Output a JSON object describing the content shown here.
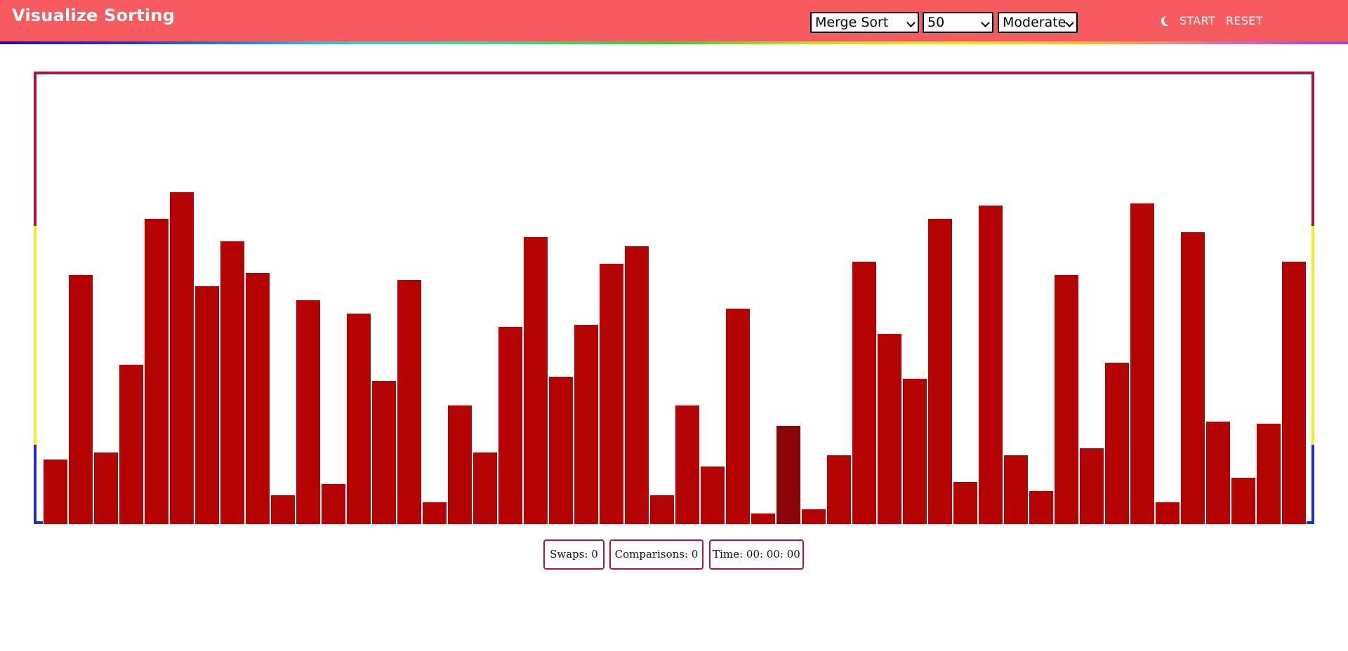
{
  "header": {
    "brand": "Visualize Sorting",
    "algorithm": {
      "selected": "Merge Sort"
    },
    "size": {
      "selected": "50"
    },
    "speed": {
      "selected": "Moderate"
    },
    "theme_icon": "moon-icon",
    "start_label": "START",
    "reset_label": "RESET"
  },
  "colors": {
    "navbar": "#f65c5f",
    "bar": "#b50303",
    "bar_active": "#8a0505",
    "frame_top": "#b0123f",
    "frame_middle": "#f2f01f",
    "frame_bottom": "#1e2cc8"
  },
  "array": {
    "max_value": 100,
    "values": [
      14.5,
      55.5,
      16,
      35.5,
      68,
      74,
      53,
      63,
      56,
      6.5,
      50,
      9,
      47,
      32,
      54.5,
      5,
      26.5,
      16,
      44,
      64,
      33,
      44.5,
      58,
      62,
      6.5,
      26.5,
      13,
      48,
      2.5,
      22,
      3.5,
      15.5,
      58.5,
      42.5,
      32.5,
      68,
      9.5,
      71,
      15.5,
      7.5,
      55.5,
      17,
      36,
      71.5,
      5,
      65,
      23,
      10.5,
      22.5,
      58.5
    ],
    "active_index": 29
  },
  "stats": {
    "swaps": "Swaps: 0",
    "comparisons": "Comparisons: 0",
    "time": "Time: 00: 00: 00"
  }
}
